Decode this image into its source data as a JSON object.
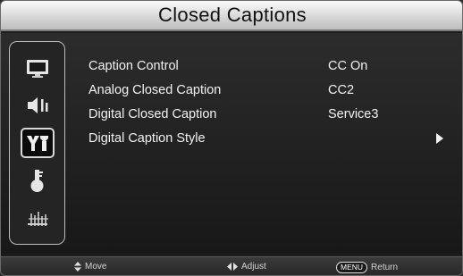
{
  "header": {
    "title": "Closed Captions"
  },
  "sidebar": {
    "items": [
      {
        "icon": "picture-icon",
        "selected": false
      },
      {
        "icon": "sound-icon",
        "selected": false
      },
      {
        "icon": "setup-icon",
        "selected": true
      },
      {
        "icon": "lock-icon",
        "selected": false
      },
      {
        "icon": "channel-icon",
        "selected": false
      }
    ]
  },
  "menu": {
    "items": [
      {
        "label": "Caption Control",
        "value": "CC On"
      },
      {
        "label": "Analog Closed Caption",
        "value": "CC2"
      },
      {
        "label": "Digital Closed Caption",
        "value": "Service3"
      },
      {
        "label": "Digital Caption Style",
        "value": "",
        "has_submenu": true
      }
    ]
  },
  "footer": {
    "move_label": "Move",
    "adjust_label": "Adjust",
    "menu_key": "MENU",
    "return_label": "Return"
  },
  "colors": {
    "title_bar": "#d8d8d8",
    "background": "#1d1d1d",
    "text": "#f2f2f2"
  }
}
